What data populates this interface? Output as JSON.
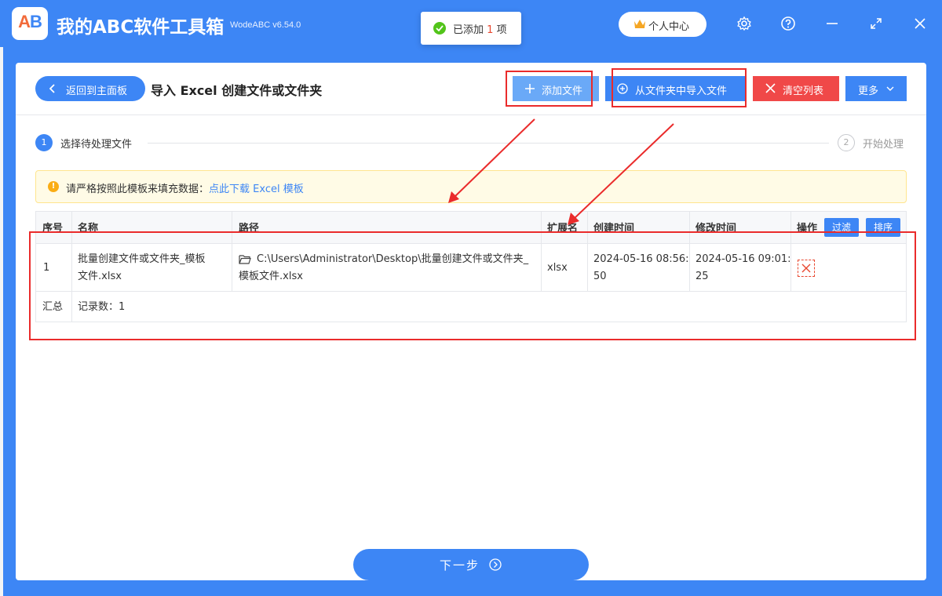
{
  "app": {
    "logo_a": "A",
    "logo_b": "B",
    "title": "我的ABC软件工具箱",
    "version": "WodeABC v6.54.0",
    "user_center": "个人中心",
    "icons": [
      "settings-icon",
      "help-icon",
      "minimize-icon",
      "maximize-icon",
      "close-icon"
    ]
  },
  "toast": {
    "prefix": "已添加",
    "count": "1",
    "suffix": "项"
  },
  "header": {
    "back_label": "返回到主面板",
    "page_title": "导入 Excel 创建文件或文件夹",
    "actions": {
      "add_file": "添加文件",
      "import_folder": "从文件夹中导入文件",
      "clear_list": "清空列表",
      "more": "更多"
    }
  },
  "steps": {
    "step1_num": "1",
    "step1_label": "选择待处理文件",
    "step2_num": "2",
    "step2_label": "开始处理"
  },
  "notice": {
    "text": "请严格按照此模板来填充数据：",
    "link": "点此下载 Excel 模板"
  },
  "table": {
    "headers": {
      "index": "序号",
      "name": "名称",
      "path": "路径",
      "ext": "扩展名",
      "created": "创建时间",
      "modified": "修改时间",
      "ops": "操作",
      "filter": "过滤",
      "sort": "排序"
    },
    "rows": [
      {
        "index": "1",
        "name_line1": "批量创建文件或文件夹_模板",
        "name_line2": "文件.xlsx",
        "path_line1": "C:\\Users\\Administrator\\Desktop\\批量创建文件或文件夹_",
        "path_line2": "模板文件.xlsx",
        "ext": "xlsx",
        "created_line1": "2024-05-16 08:56:",
        "created_line2": "50",
        "modified_line1": "2024-05-16 09:01:",
        "modified_line2": "25"
      }
    ],
    "summary": {
      "label": "汇总",
      "records": "记录数：1"
    }
  },
  "footer": {
    "next": "下一步"
  },
  "colors": {
    "primary": "#3d86f5",
    "danger": "#f04848",
    "annotation": "#ea2b2b"
  }
}
